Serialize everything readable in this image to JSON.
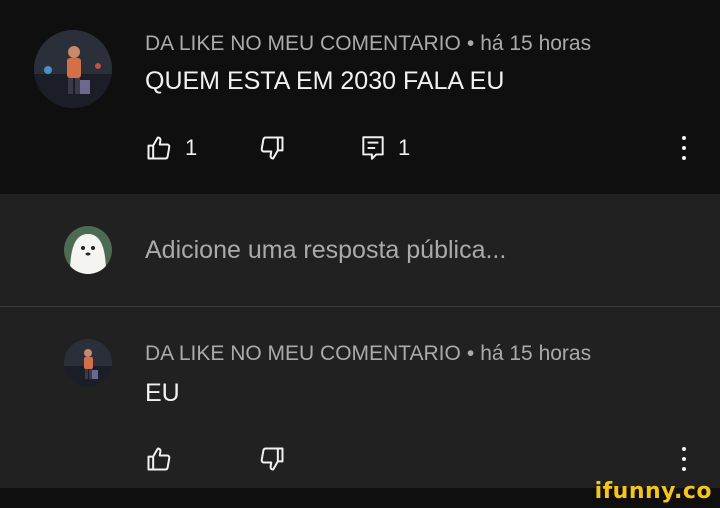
{
  "comment": {
    "author": "DA LIKE NO MEU COMENTARIO",
    "separator": "•",
    "time": "há 15 horas",
    "text": "QUEM ESTA EM 2030 FALA EU",
    "like_count": "1",
    "reply_count": "1"
  },
  "reply_box": {
    "placeholder": "Adicione uma resposta pública..."
  },
  "reply": {
    "author": "DA LIKE NO MEU COMENTARIO",
    "separator": "•",
    "time": "há 15 horas",
    "text": "EU"
  },
  "watermark": {
    "text": "ifunny.co"
  },
  "colors": {
    "background": "#0f0f0f",
    "reply_background": "#212121",
    "meta_text": "#aaaaaa",
    "primary_text": "#f1f1f1",
    "watermark": "#f5c518"
  }
}
